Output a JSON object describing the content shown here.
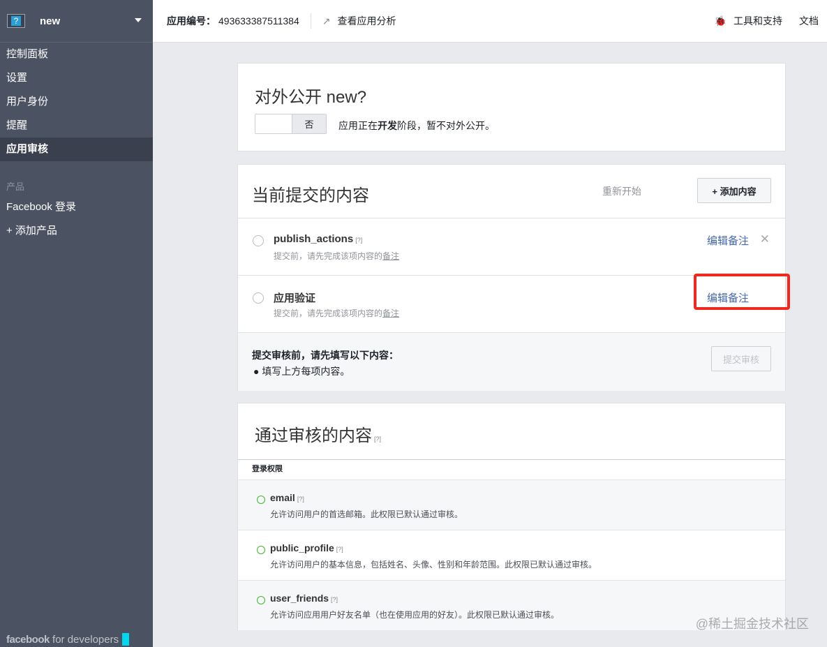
{
  "sidebar": {
    "app_name": "new",
    "items": [
      "控制面板",
      "设置",
      "用户身份",
      "提醒",
      "应用审核"
    ],
    "section": "产品",
    "products": [
      "Facebook 登录",
      "+ 添加产品"
    ],
    "footer_brand": "facebook",
    "footer_text": "for developers"
  },
  "topbar": {
    "app_id_label": "应用编号：",
    "app_id": "493633387511384",
    "analytics": "查看应用分析",
    "tools": "工具和支持",
    "docs": "文档"
  },
  "public_card": {
    "title": "对外公开 new?",
    "toggle_value": "否",
    "status_pre": "应用正在",
    "status_bold": "开发",
    "status_post": "阶段，暂不对外公开。"
  },
  "submission": {
    "title": "当前提交的内容",
    "restart": "重新开始",
    "add": "+ 添加内容",
    "items": [
      {
        "name": "publish_actions",
        "help": "[?]",
        "sub": "提交前，请先完成该项内容的",
        "sub_link": "备注",
        "action": "编辑备注",
        "close": "✕"
      },
      {
        "name": "应用验证",
        "sub": "提交前，请先完成该项内容的",
        "sub_link": "备注",
        "action": "编辑备注"
      }
    ],
    "footer_title": "提交审核前，请先填写以下内容：",
    "footer_bullet": "填写上方每项内容。",
    "submit": "提交审核"
  },
  "approved": {
    "title": "通过审核的内容",
    "help": "[?]",
    "section": "登录权限",
    "items": [
      {
        "name": "email",
        "help": "[?]",
        "desc": "允许访问用户的首选邮箱。此权限已默认通过审核。"
      },
      {
        "name": "public_profile",
        "help": "[?]",
        "desc": "允许访问用户的基本信息，包括姓名、头像、性别和年龄范围。此权限已默认通过审核。"
      },
      {
        "name": "user_friends",
        "help": "[?]",
        "desc": "允许访问应用用户好友名单（也在使用应用的好友）。此权限已默认通过审核。"
      }
    ]
  },
  "watermark": "@稀土掘金技术社区",
  "colors": {
    "sidebar": "#4b5363",
    "link": "#4267b2",
    "highlight": "#f0291e"
  }
}
